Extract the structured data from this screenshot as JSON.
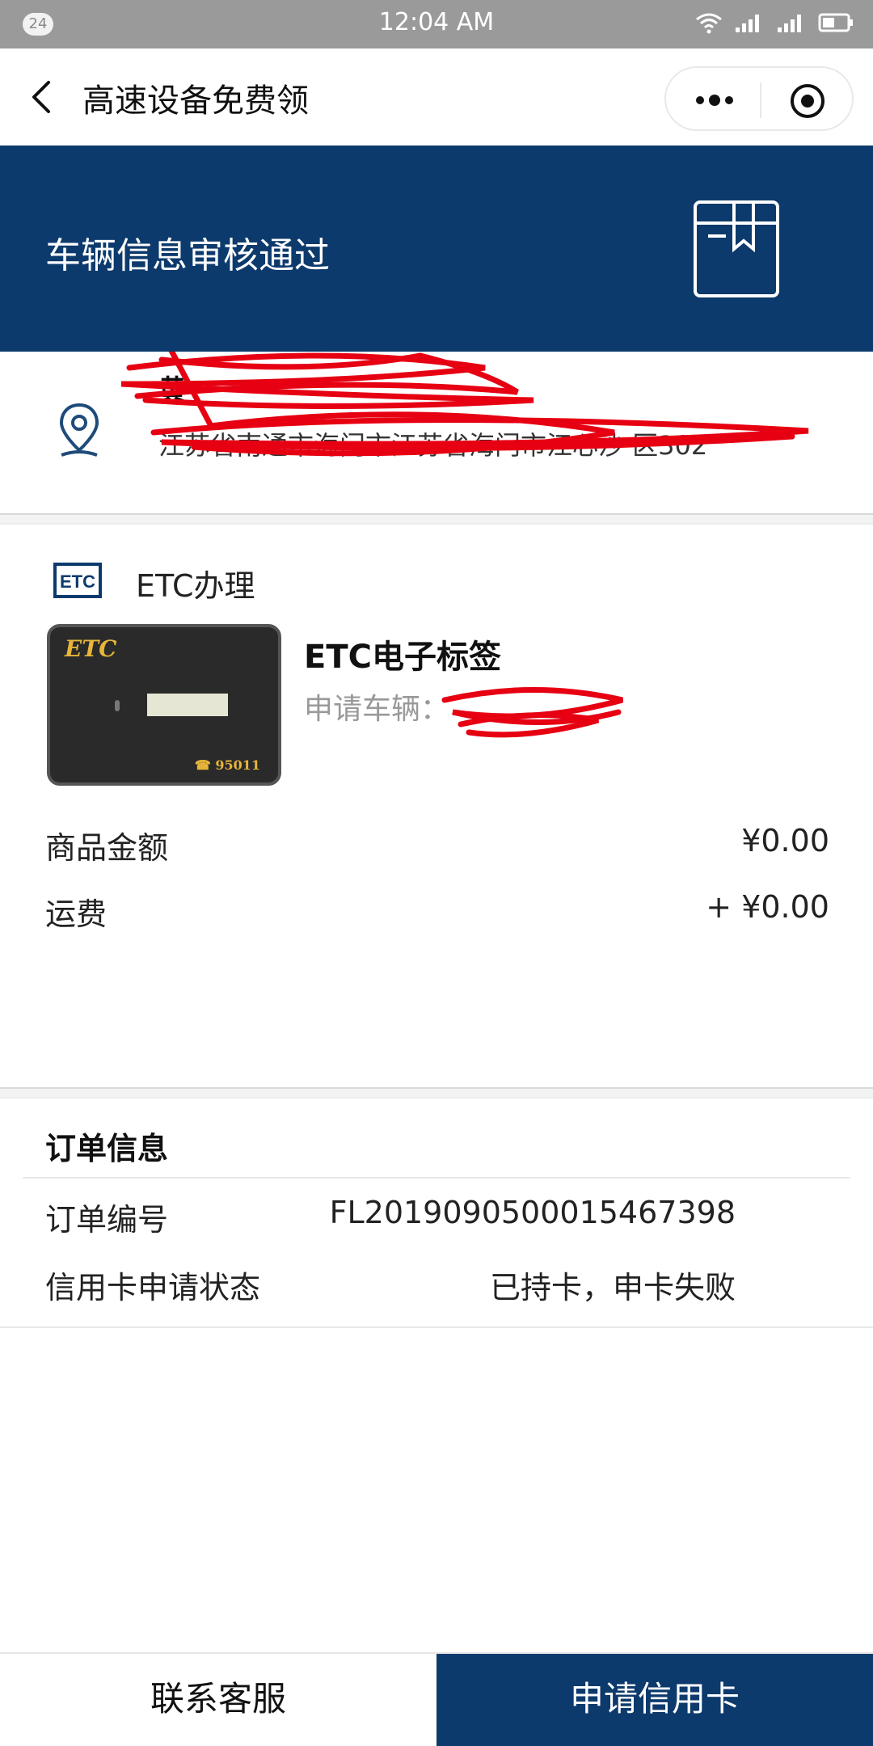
{
  "status_bar": {
    "badge": "24",
    "time": "12:04 AM"
  },
  "header": {
    "title": "高速设备免费领"
  },
  "banner": {
    "text": "车辆信息审核通过"
  },
  "address": {
    "name": "黄",
    "line": "江苏省南通市海门市江苏省海门市江心沙 区302"
  },
  "etc": {
    "section_label": "ETC办理",
    "logo_text": "ETC",
    "product_image_brand": "ETC",
    "product_image_phone": "☎ 95011",
    "product_title": "ETC电子标签",
    "product_sub": "申请车辆："
  },
  "pricing": {
    "amount_label": "商品金额",
    "amount_value": "¥0.00",
    "shipping_label": "运费",
    "shipping_value": "+ ¥0.00"
  },
  "order": {
    "title": "订单信息",
    "number_label": "订单编号",
    "number_value": "FL2019090500015467398",
    "status_label": "信用卡申请状态",
    "status_value": "已持卡，申卡失败"
  },
  "actions": {
    "service_label": "联系客服",
    "apply_label": "申请信用卡"
  },
  "colors": {
    "brand": "#0d3a6c",
    "statusbar": "#9a9a9a",
    "redaction": "#e60012"
  }
}
